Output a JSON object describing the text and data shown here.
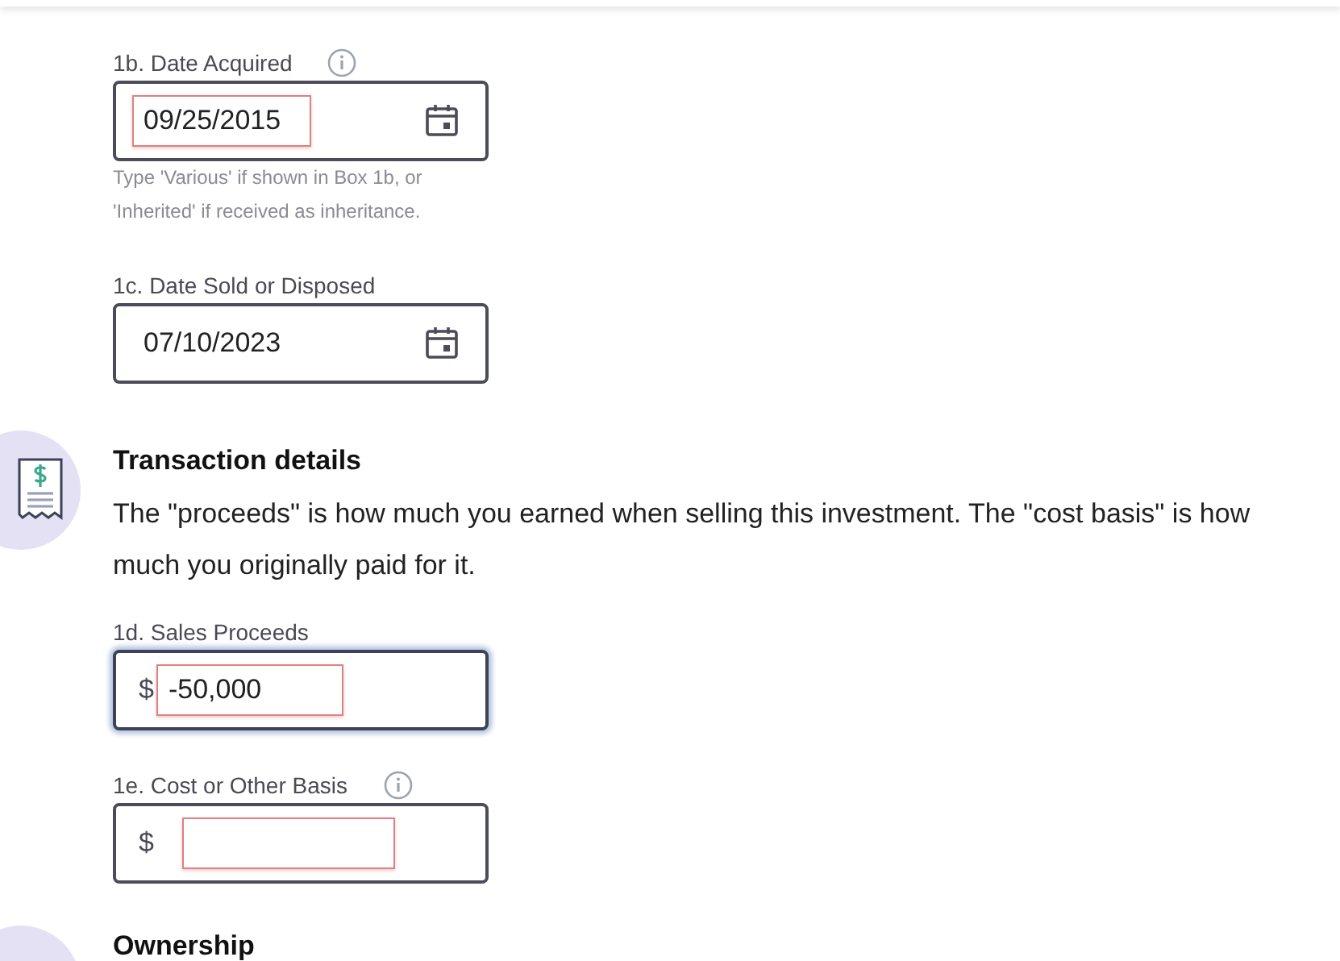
{
  "date_fields": [
    {
      "label": "1b. Date Acquired",
      "info": true,
      "value": "09/25/2015",
      "highlighted": true,
      "focused": false,
      "hint": [
        "Type 'Various' if shown in Box 1b, or",
        "'Inherited' if received as inheritance."
      ]
    },
    {
      "label": "1c. Date Sold or Disposed",
      "info": false,
      "value": "07/10/2023",
      "highlighted": false,
      "focused": false
    }
  ],
  "transaction": {
    "heading": "Transaction details",
    "description": "The \"proceeds\" is how much you earned when selling this investment. The \"cost basis\" is how much you originally paid for it.",
    "fields": [
      {
        "label": "1d. Sales Proceeds",
        "info": false,
        "prefix": "$",
        "value": "-50,000",
        "highlighted": true,
        "focused": true
      },
      {
        "label": "1e. Cost or Other Basis",
        "info": true,
        "prefix": "$",
        "highlighted": true,
        "focused": false
      }
    ]
  },
  "next_section": {
    "heading": "Ownership"
  }
}
